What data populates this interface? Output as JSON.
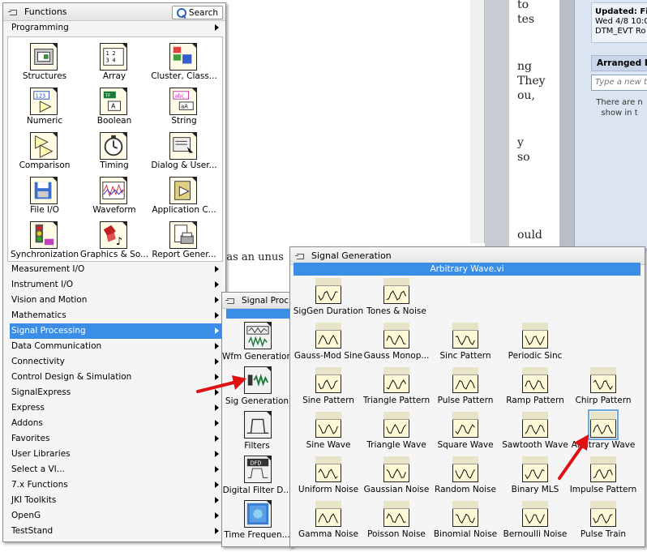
{
  "background": {
    "doc_lines": [
      "to",
      "tes",
      "ng",
      "They",
      "ou,",
      "y",
      "so",
      "ould"
    ],
    "doc_footer": "t as an unus",
    "outlook": {
      "updated_label": "Updated: Fis",
      "updated_line2": "Wed 4/8 10:0",
      "updated_line3": "DTM_EVT Ro",
      "arranged_by": "Arranged By:",
      "task_placeholder": "Type a new t",
      "empty_line1": "There are n",
      "empty_line2": "show in t"
    }
  },
  "functions_palette": {
    "title": "Functions",
    "search_label": "Search",
    "programming_label": "Programming",
    "tiles": [
      {
        "label": "Structures",
        "icon": "structures-icon"
      },
      {
        "label": "Array",
        "icon": "array-icon"
      },
      {
        "label": "Cluster, Class...",
        "icon": "cluster-icon"
      },
      {
        "label": "Numeric",
        "icon": "numeric-icon"
      },
      {
        "label": "Boolean",
        "icon": "boolean-icon"
      },
      {
        "label": "String",
        "icon": "string-icon"
      },
      {
        "label": "Comparison",
        "icon": "comparison-icon"
      },
      {
        "label": "Timing",
        "icon": "timing-icon"
      },
      {
        "label": "Dialog & User...",
        "icon": "dialog-icon"
      },
      {
        "label": "File I/O",
        "icon": "file-io-icon"
      },
      {
        "label": "Waveform",
        "icon": "waveform-icon"
      },
      {
        "label": "Application C...",
        "icon": "application-control-icon"
      },
      {
        "label": "Synchronization",
        "icon": "synchronization-icon"
      },
      {
        "label": "Graphics & So...",
        "icon": "graphics-sound-icon"
      },
      {
        "label": "Report Gener...",
        "icon": "report-generation-icon"
      }
    ],
    "categories": [
      "Measurement I/O",
      "Instrument I/O",
      "Vision and Motion",
      "Mathematics",
      "Signal Processing",
      "Data Communication",
      "Connectivity",
      "Control Design & Simulation",
      "SignalExpress",
      "Express",
      "Addons",
      "Favorites",
      "User Libraries",
      "Select a VI...",
      "7.x Functions",
      "JKI Toolkits",
      "OpenG",
      "TestStand"
    ],
    "selected_category": "Signal Processing"
  },
  "signal_processing_palette": {
    "title": "Signal Proc",
    "tiles": [
      {
        "label": "Wfm Generation",
        "icon": "wfm-generation-icon"
      },
      {
        "label": "Sig Generation",
        "icon": "sig-generation-icon"
      },
      {
        "label": "Filters",
        "icon": "filters-icon"
      },
      {
        "label": "Digital Filter D...",
        "icon": "digital-filter-icon"
      },
      {
        "label": "Time Frequen...",
        "icon": "time-frequency-icon"
      }
    ]
  },
  "signal_generation_palette": {
    "title": "Signal Generation",
    "highlighted_vi": "Arbitrary Wave.vi",
    "tiles": [
      {
        "label": "SigGen Duration"
      },
      {
        "label": "Tones & Noise"
      },
      {
        "label": "Gauss-Mod Sine"
      },
      {
        "label": "Gauss Monop..."
      },
      {
        "label": "Sinc Pattern"
      },
      {
        "label": "Periodic Sinc"
      },
      {
        "label": "Sine Pattern"
      },
      {
        "label": "Triangle Pattern"
      },
      {
        "label": "Pulse Pattern"
      },
      {
        "label": "Ramp Pattern"
      },
      {
        "label": "Chirp Pattern"
      },
      {
        "label": "Sine Wave"
      },
      {
        "label": "Triangle Wave"
      },
      {
        "label": "Square Wave"
      },
      {
        "label": "Sawtooth Wave"
      },
      {
        "label": "Arbitrary Wave"
      },
      {
        "label": "Uniform Noise"
      },
      {
        "label": "Gaussian Noise"
      },
      {
        "label": "Random Noise"
      },
      {
        "label": "Binary MLS"
      },
      {
        "label": "Impulse Pattern"
      },
      {
        "label": "Gamma Noise"
      },
      {
        "label": "Poisson Noise"
      },
      {
        "label": "Binomial Noise"
      },
      {
        "label": "Bernoulli Noise"
      },
      {
        "label": "Pulse Train"
      }
    ],
    "selected_tile": "Arbitrary Wave"
  },
  "colors": {
    "selection": "#3a8ee6",
    "arrow": "#e01010"
  }
}
